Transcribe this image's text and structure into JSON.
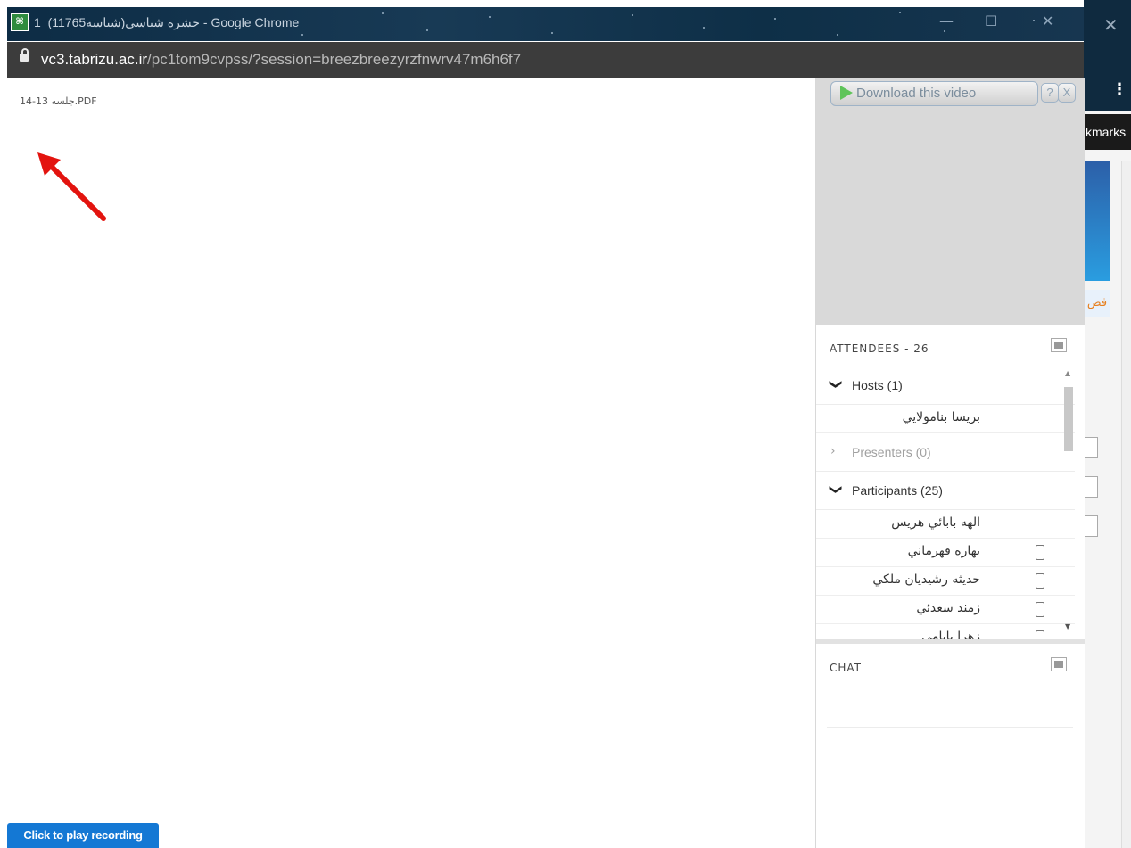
{
  "window": {
    "title": "حشره شناسی(شناسه11765)_1 - Google Chrome",
    "controls": {
      "minimize": "—",
      "maximize": "☐",
      "close": "✕"
    }
  },
  "address_bar": {
    "host": "vc3.tabrizu.ac.ir",
    "path": "/pc1tom9cvpss/?session=breezbreezyrzfnwrv47m6h6f7"
  },
  "document": {
    "file_name": "14-13 جلسه.PDF"
  },
  "recording": {
    "play_label": "Click to play recording"
  },
  "video_pod": {
    "download_label": "Download this video",
    "help_label": "?",
    "close_label": "X"
  },
  "attendees": {
    "title": "ATTENDEES - 26",
    "groups": {
      "hosts": {
        "label": "Hosts (1)",
        "chevron": "❯"
      },
      "presenters": {
        "label": "Presenters (0)",
        "chevron": "›"
      },
      "participants": {
        "label": "Participants (25)",
        "chevron": "❯"
      }
    },
    "hosts": [
      "بريسا بناموﻻيي"
    ],
    "participants": [
      "الهه بابائي هريس",
      "بهاره قهرماني",
      "حديثه رشيديان ملكي",
      "زمند سعدئي",
      "زهرا بابامي"
    ]
  },
  "chat": {
    "title": "CHAT"
  },
  "background_window": {
    "bookmarks_fragment": "kmarks",
    "tab_fragment": "فص"
  },
  "colors": {
    "play_button": "#1478d4",
    "address_bar": "#3c3c3c",
    "title_bar": "#0d2c45",
    "annotation_arrow": "#e3140f"
  }
}
